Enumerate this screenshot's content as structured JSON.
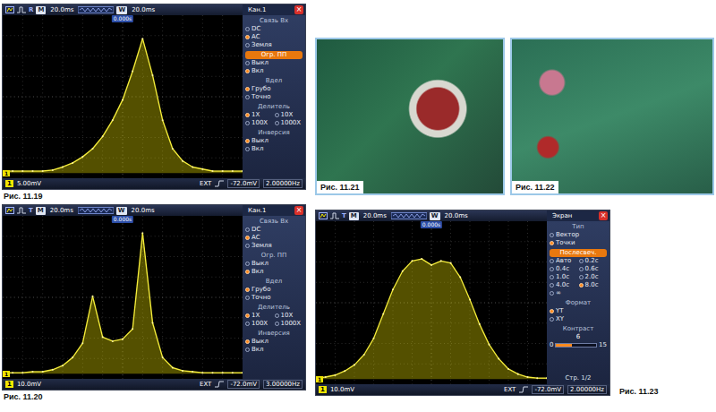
{
  "scopes": [
    {
      "caption": "Рис. 11.19",
      "mode": "R",
      "m_label": "M",
      "m_time": "20.0ms",
      "w_label": "W",
      "w_time": "20.0ms",
      "trigger_time": "0.000s",
      "menu": {
        "title": "Кан.1",
        "close": "×",
        "sections": [
          {
            "title": "Связь Вх",
            "highlighted": false,
            "kind": "list",
            "options": [
              {
                "label": "DC",
                "selected": false
              },
              {
                "label": "AC",
                "selected": true
              },
              {
                "label": "Земля",
                "selected": false
              }
            ]
          },
          {
            "title": "Огр. ПП",
            "highlighted": true,
            "kind": "list",
            "options": [
              {
                "label": "Выкл",
                "selected": false
              },
              {
                "label": "Вкл",
                "selected": true
              }
            ]
          },
          {
            "title": "Вдел",
            "highlighted": false,
            "kind": "list",
            "options": [
              {
                "label": "Грубо",
                "selected": true
              },
              {
                "label": "Точно",
                "selected": false
              }
            ]
          },
          {
            "title": "Делитель",
            "highlighted": false,
            "kind": "grid",
            "options": [
              {
                "label": "1X",
                "selected": true
              },
              {
                "label": "10X",
                "selected": false
              },
              {
                "label": "100X",
                "selected": false
              },
              {
                "label": "1000X",
                "selected": false
              }
            ]
          },
          {
            "title": "Инверсия",
            "highlighted": false,
            "kind": "list",
            "options": [
              {
                "label": "Выкл",
                "selected": true
              },
              {
                "label": "Вкл",
                "selected": false
              }
            ]
          }
        ]
      },
      "status": {
        "channel": "1",
        "scale": "5.00mV",
        "source": "EXT",
        "level": "-72.0mV",
        "frequency": "2.00000Hz"
      },
      "trace": {
        "values": [
          0.1,
          0.1,
          0.1,
          0.1,
          0.1,
          0.15,
          0.3,
          0.5,
          0.8,
          1.2,
          1.8,
          2.6,
          3.6,
          5.0,
          6.6,
          4.8,
          2.6,
          1.2,
          0.6,
          0.3,
          0.2,
          0.1,
          0.1,
          0.1,
          0.1
        ]
      }
    },
    {
      "caption": "Рис. 11.20",
      "mode": "T",
      "m_label": "M",
      "m_time": "20.0ms",
      "w_label": "W",
      "w_time": "20.0ms",
      "trigger_time": "0.000s",
      "menu": {
        "title": "Кан.1",
        "close": "×",
        "sections": [
          {
            "title": "Связь Вх",
            "highlighted": false,
            "kind": "list",
            "options": [
              {
                "label": "DC",
                "selected": false
              },
              {
                "label": "AC",
                "selected": true
              },
              {
                "label": "Земля",
                "selected": false
              }
            ]
          },
          {
            "title": "Огр. ПП",
            "highlighted": false,
            "kind": "list",
            "options": [
              {
                "label": "Выкл",
                "selected": false
              },
              {
                "label": "Вкл",
                "selected": true
              }
            ]
          },
          {
            "title": "Вдел",
            "highlighted": false,
            "kind": "list",
            "options": [
              {
                "label": "Грубо",
                "selected": true
              },
              {
                "label": "Точно",
                "selected": false
              }
            ]
          },
          {
            "title": "Делитель",
            "highlighted": false,
            "kind": "grid",
            "options": [
              {
                "label": "1X",
                "selected": true
              },
              {
                "label": "10X",
                "selected": false
              },
              {
                "label": "100X",
                "selected": false
              },
              {
                "label": "1000X",
                "selected": false
              }
            ]
          },
          {
            "title": "Инверсия",
            "highlighted": false,
            "kind": "list",
            "options": [
              {
                "label": "Выкл",
                "selected": true
              },
              {
                "label": "Вкл",
                "selected": false
              }
            ]
          }
        ]
      },
      "status": {
        "channel": "1",
        "scale": "10.0mV",
        "source": "EXT",
        "level": "-72.0mV",
        "frequency": "3.00000Hz"
      },
      "trace": {
        "values": [
          0.05,
          0.05,
          0.05,
          0.1,
          0.1,
          0.2,
          0.4,
          0.8,
          1.5,
          3.8,
          1.8,
          1.6,
          1.7,
          2.2,
          6.9,
          2.5,
          0.8,
          0.3,
          0.15,
          0.1,
          0.05,
          0.05,
          0.05,
          0.05,
          0.05
        ]
      }
    },
    {
      "caption": "Рис. 11.23",
      "mode": "T",
      "m_label": "M",
      "m_time": "20.0ms",
      "w_label": "W",
      "w_time": "20.0ms",
      "trigger_time": "0.000s",
      "menu": {
        "title": "Экран",
        "close": "×",
        "footer": "Стр. 1/2",
        "sections": [
          {
            "title": "Тип",
            "highlighted": false,
            "kind": "list",
            "options": [
              {
                "label": "Вектор",
                "selected": false
              },
              {
                "label": "Точки",
                "selected": true
              }
            ]
          },
          {
            "title": "Послесвеч.",
            "highlighted": true,
            "kind": "grid",
            "options": [
              {
                "label": "Авто",
                "selected": false
              },
              {
                "label": "0.2с",
                "selected": false
              },
              {
                "label": "0.4с",
                "selected": false
              },
              {
                "label": "0.6с",
                "selected": false
              },
              {
                "label": "1.0с",
                "selected": false
              },
              {
                "label": "2.0с",
                "selected": false
              },
              {
                "label": "4.0с",
                "selected": false
              },
              {
                "label": "8.0с",
                "selected": true
              },
              {
                "label": "∞",
                "selected": false
              }
            ]
          },
          {
            "title": "Формат",
            "highlighted": false,
            "kind": "list",
            "options": [
              {
                "label": "YT",
                "selected": true
              },
              {
                "label": "XY",
                "selected": false
              }
            ]
          },
          {
            "title": "Контраст",
            "highlighted": false,
            "kind": "slider",
            "value": "6",
            "min": "0",
            "max": "15",
            "level": 0.4
          }
        ]
      },
      "status": {
        "channel": "1",
        "scale": "10.0mV",
        "source": "EXT",
        "level": "-72.0mV",
        "frequency": "2.00000Hz"
      },
      "trace": {
        "values": [
          0.05,
          0.1,
          0.2,
          0.4,
          0.7,
          1.2,
          2.0,
          3.2,
          4.4,
          5.3,
          5.8,
          5.9,
          5.6,
          5.8,
          5.7,
          5.0,
          3.9,
          2.7,
          1.7,
          1.0,
          0.5,
          0.25,
          0.1,
          0.05,
          0.05
        ]
      }
    }
  ],
  "photos": [
    {
      "caption": "Рис. 11.21"
    },
    {
      "caption": "Рис. 11.22"
    }
  ]
}
